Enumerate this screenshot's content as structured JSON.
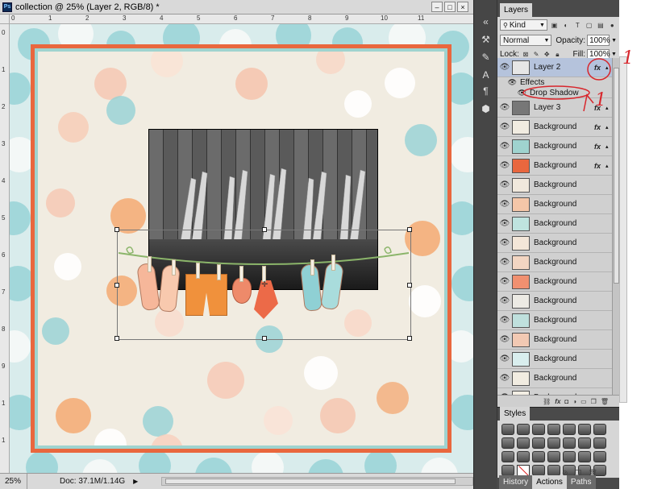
{
  "document": {
    "title": "collection @ 25% (Layer 2, RGB/8) *",
    "zoom": "25%",
    "doc_info": "Doc: 37.1M/1.14G",
    "ruler_top": [
      "0",
      "1",
      "2",
      "3",
      "4",
      "5",
      "6",
      "7",
      "8",
      "9",
      "10",
      "11"
    ],
    "ruler_left": [
      "0",
      "1",
      "2",
      "3",
      "4",
      "5",
      "6",
      "7",
      "8",
      "9",
      "1",
      "1"
    ]
  },
  "layers_panel": {
    "tab_label": "Layers",
    "filter_kind": "Kind",
    "blend_mode": "Normal",
    "opacity_label": "Opacity:",
    "opacity_value": "100%",
    "lock_label": "Lock:",
    "fill_label": "Fill:",
    "fill_value": "100%",
    "effects_label": "Effects",
    "drop_shadow_label": "Drop Shadow",
    "fx_label": "fx",
    "layers": [
      {
        "name": "Layer 2",
        "selected": true,
        "fx": true,
        "thumb": "#e6e6e6"
      },
      {
        "name": "Layer 3",
        "selected": false,
        "fx": true,
        "thumb": "#777777"
      },
      {
        "name": "Background",
        "selected": false,
        "fx": true,
        "thumb": "#f1ece1"
      },
      {
        "name": "Background",
        "selected": false,
        "fx": true,
        "thumb": "#9fd3cf"
      },
      {
        "name": "Background",
        "selected": false,
        "fx": true,
        "thumb": "#e9673e"
      },
      {
        "name": "Background",
        "selected": false,
        "fx": false,
        "thumb": "#f0e8dc"
      },
      {
        "name": "Background",
        "selected": false,
        "fx": false,
        "thumb": "#f4c6a8"
      },
      {
        "name": "Background",
        "selected": false,
        "fx": false,
        "thumb": "#bfe3df"
      },
      {
        "name": "Background",
        "selected": false,
        "fx": false,
        "thumb": "#f3e6d8"
      },
      {
        "name": "Background",
        "selected": false,
        "fx": false,
        "thumb": "#f2d5c2"
      },
      {
        "name": "Background",
        "selected": false,
        "fx": false,
        "thumb": "#f09070"
      },
      {
        "name": "Background",
        "selected": false,
        "fx": false,
        "thumb": "#eceae4"
      },
      {
        "name": "Background",
        "selected": false,
        "fx": false,
        "thumb": "#bfe0dd"
      },
      {
        "name": "Background",
        "selected": false,
        "fx": false,
        "thumb": "#f2c9b3"
      },
      {
        "name": "Background",
        "selected": false,
        "fx": false,
        "thumb": "#d9eeee"
      },
      {
        "name": "Background",
        "selected": false,
        "fx": false,
        "thumb": "#f1ece1"
      },
      {
        "name": "Background",
        "selected": false,
        "fx": false,
        "thumb": "#f3eee4"
      }
    ]
  },
  "styles_panel": {
    "tab_label": "Styles"
  },
  "bottom_tabs": [
    "History",
    "Actions",
    "Paths"
  ],
  "annotations": [
    "1",
    "1"
  ],
  "colors": {
    "frame_red": "#e9673e",
    "frame_teal": "#9fd3cf",
    "paper_cream": "#f1ece1",
    "selected_layer": "#b5c3dc",
    "annotation_red": "#d8262c"
  }
}
